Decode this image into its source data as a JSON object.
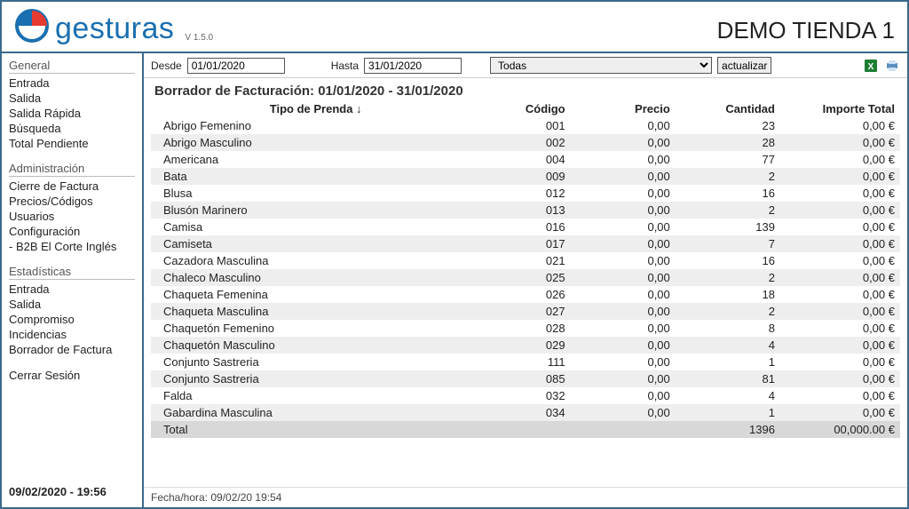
{
  "app": {
    "brand": "gesturas",
    "version": "V 1.5.0",
    "store": "DEMO TIENDA 1"
  },
  "sidebar": {
    "groups": [
      {
        "heading": "General",
        "items": [
          "Entrada",
          "Salida",
          "Salida Rápida",
          "Búsqueda",
          "Total Pendiente"
        ]
      },
      {
        "heading": "Administración",
        "items": [
          "Cierre de Factura",
          "Precios/Códigos",
          "Usuarios",
          "Configuración",
          "- B2B El Corte Inglés"
        ]
      },
      {
        "heading": "Estadísticas",
        "items": [
          "Entrada",
          "Salida",
          "Compromiso",
          "Incidencias",
          "Borrador de Factura"
        ]
      }
    ],
    "logout": "Cerrar Sesión",
    "clock": "09/02/2020 - 19:56"
  },
  "filterbar": {
    "from_label": "Desde",
    "from_value": "01/01/2020",
    "to_label": "Hasta",
    "to_value": "31/01/2020",
    "filter_value": "Todas",
    "update_label": "actualizar"
  },
  "report": {
    "title": "Borrador de Facturación: 01/01/2020 - 31/01/2020",
    "columns": {
      "name": "Tipo de Prenda ↓",
      "code": "Código",
      "price": "Precio",
      "qty": "Cantidad",
      "total": "Importe Total"
    },
    "rows": [
      {
        "name": "Abrigo Femenino",
        "code": "001",
        "price": "0,00",
        "qty": "23",
        "total": "0,00 €"
      },
      {
        "name": "Abrigo Masculino",
        "code": "002",
        "price": "0,00",
        "qty": "28",
        "total": "0,00 €"
      },
      {
        "name": "Americana",
        "code": "004",
        "price": "0,00",
        "qty": "77",
        "total": "0,00 €"
      },
      {
        "name": "Bata",
        "code": "009",
        "price": "0,00",
        "qty": "2",
        "total": "0,00 €"
      },
      {
        "name": "Blusa",
        "code": "012",
        "price": "0,00",
        "qty": "16",
        "total": "0,00 €"
      },
      {
        "name": "Blusón Marinero",
        "code": "013",
        "price": "0,00",
        "qty": "2",
        "total": "0,00 €"
      },
      {
        "name": "Camisa",
        "code": "016",
        "price": "0,00",
        "qty": "139",
        "total": "0,00 €"
      },
      {
        "name": "Camiseta",
        "code": "017",
        "price": "0,00",
        "qty": "7",
        "total": "0,00 €"
      },
      {
        "name": "Cazadora Masculina",
        "code": "021",
        "price": "0,00",
        "qty": "16",
        "total": "0,00 €"
      },
      {
        "name": "Chaleco Masculino",
        "code": "025",
        "price": "0,00",
        "qty": "2",
        "total": "0,00 €"
      },
      {
        "name": "Chaqueta Femenina",
        "code": "026",
        "price": "0,00",
        "qty": "18",
        "total": "0,00 €"
      },
      {
        "name": "Chaqueta Masculina",
        "code": "027",
        "price": "0,00",
        "qty": "2",
        "total": "0,00 €"
      },
      {
        "name": "Chaquetón Femenino",
        "code": "028",
        "price": "0,00",
        "qty": "8",
        "total": "0,00 €"
      },
      {
        "name": "Chaquetón Masculino",
        "code": "029",
        "price": "0,00",
        "qty": "4",
        "total": "0,00 €"
      },
      {
        "name": "Conjunto Sastreria",
        "code": "111",
        "price": "0,00",
        "qty": "1",
        "total": "0,00 €"
      },
      {
        "name": "Conjunto Sastreria",
        "code": "085",
        "price": "0,00",
        "qty": "81",
        "total": "0,00 €"
      },
      {
        "name": "Falda",
        "code": "032",
        "price": "0,00",
        "qty": "4",
        "total": "0,00 €"
      },
      {
        "name": "Gabardina Masculina",
        "code": "034",
        "price": "0,00",
        "qty": "1",
        "total": "0,00 €"
      }
    ],
    "totals": {
      "label": "Total",
      "qty": "1396",
      "amount": "00,000.00 €"
    },
    "timestamp": "Fecha/hora: 09/02/20 19:54"
  }
}
